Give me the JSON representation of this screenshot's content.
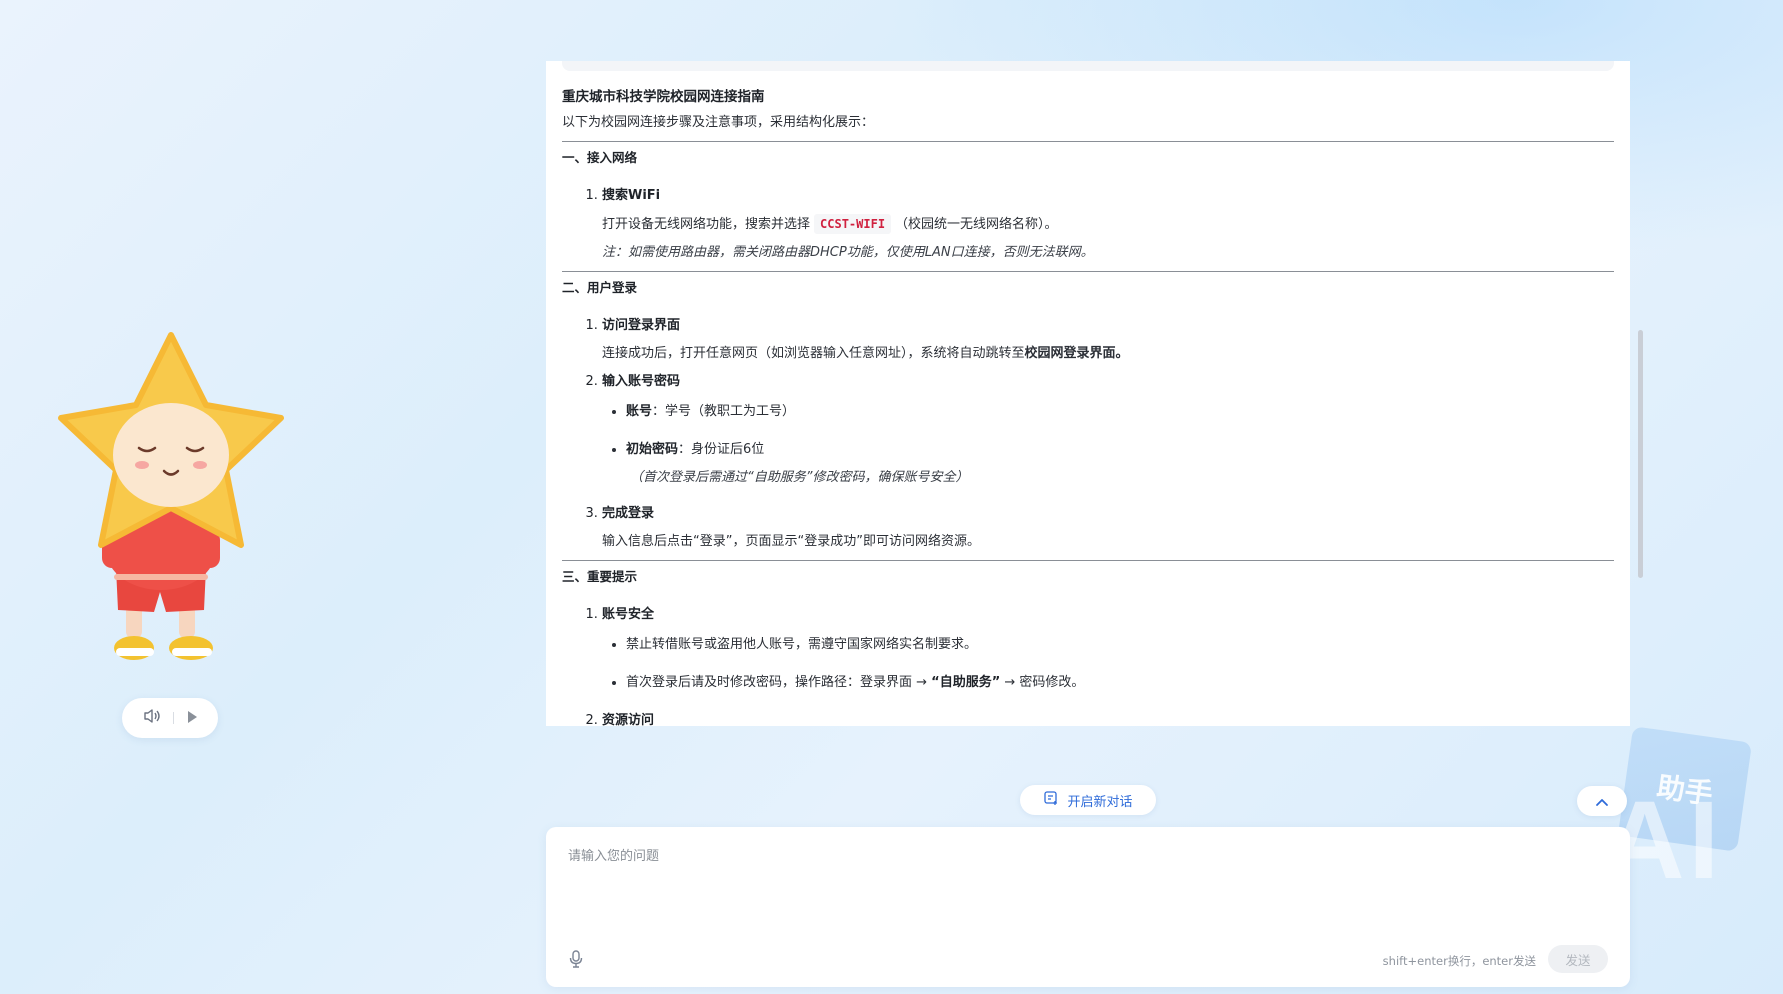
{
  "background": {
    "watermark_ai": "AI",
    "watermark_card": "助手"
  },
  "article": {
    "title": "重庆城市科技学院校园网连接指南",
    "intro": "以下为校园网连接步骤及注意事项，采用结构化展示：",
    "section1": {
      "title": "一、接入网络",
      "step1_head": "搜索WiFi",
      "step1_body_pre": "打开设备无线网络功能，搜索并选择",
      "step1_code": "CCST-WIFI",
      "step1_body_post": "（校园统一无线网络名称）。",
      "step1_note": "注：如需使用路由器，需关闭路由器DHCP功能，仅使用LAN口连接，否则无法联网。"
    },
    "section2": {
      "title": "二、用户登录",
      "step1_head": "访问登录界面",
      "step1_body_pre": "连接成功后，打开任意网页（如浏览器输入任意网址），系统将自动跳转至",
      "step1_body_bold": "校园网登录界面。",
      "step2_head": "输入账号密码",
      "bullet1_label": "账号",
      "bullet1_text": "：学号（教职工为工号）",
      "bullet2_label": "初始密码",
      "bullet2_text": "：身份证后6位",
      "bullet2_note": "（首次登录后需通过“自助服务”修改密码，确保账号安全）",
      "step3_head": "完成登录",
      "step3_body": "输入信息后点击“登录”，页面显示“登录成功”即可访问网络资源。"
    },
    "section3": {
      "title": "三、重要提示",
      "step1_head": "账号安全",
      "bullet1_text": "禁止转借账号或盗用他人账号，需遵守国家网络实名制要求。",
      "bullet2_pre": "首次登录后请及时修改密码，操作路径：登录界面 →",
      "bullet2_bold": "“自助服务”",
      "bullet2_post": "→ 密码修改。",
      "step2_head": "资源访问"
    }
  },
  "actions": {
    "new_chat_label": "开启新对话"
  },
  "input": {
    "placeholder": "请输入您的问题",
    "hint": "shift+enter换行，enter发送",
    "send_label": "发送"
  }
}
